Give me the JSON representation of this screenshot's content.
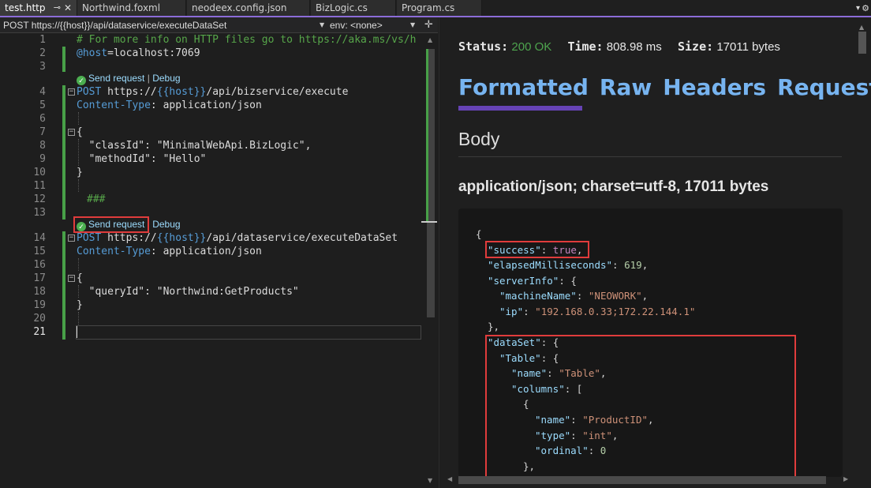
{
  "tabs": [
    {
      "label": "test.http",
      "active": true
    },
    {
      "label": "Northwind.foxml"
    },
    {
      "label": "neodeex.config.json"
    },
    {
      "label": "BizLogic.cs"
    },
    {
      "label": "Program.cs"
    }
  ],
  "tab_pin_glyph": "⊸",
  "tab_close_glyph": "✕",
  "navbar": {
    "request_selector": "POST https://{{host}}/api/dataservice/executeDataSet",
    "env_selector": "env: <none>"
  },
  "editor": {
    "line_numbers": [
      "1",
      "2",
      "3",
      "4",
      "5",
      "6",
      "7",
      "8",
      "9",
      "10",
      "11",
      "12",
      "13",
      "14",
      "15",
      "16",
      "17",
      "18",
      "19",
      "20",
      "21"
    ],
    "codelens": {
      "send": "Send request",
      "separator": "|",
      "debug": "Debug"
    },
    "lines": {
      "l1": "# For more info on HTTP files go to https://aka.ms/vs/h",
      "l2_var": "@host",
      "l2_val": "=localhost:7069",
      "l4_method": "POST",
      "l4_url1": " https://",
      "l4_tpl": "{{host}}",
      "l4_url2": "/api/bizservice/execute",
      "l5_key": "Content-Type",
      "l5_val": ": application/json",
      "l7": "{",
      "l8_key": "  \"classId\"",
      "l8_val": ": \"MinimalWebApi.BizLogic\",",
      "l9_key": "  \"methodId\"",
      "l9_val": ": \"Hello\"",
      "l10": "}",
      "l12": "###",
      "l14_method": "POST",
      "l14_url1": " https://",
      "l14_tpl": "{{host}}",
      "l14_url2": "/api/dataservice/executeDataSet",
      "l15_key": "Content-Type",
      "l15_val": ": application/json",
      "l17": "{",
      "l18_key": "  \"queryId\"",
      "l18_val": ": \"Northwind:GetProducts\"",
      "l19": "}"
    }
  },
  "response": {
    "status_label": "Status:",
    "status_value": "200 OK",
    "time_label": "Time:",
    "time_value": "808.98 ms",
    "size_label": "Size:",
    "size_value": "17011 bytes",
    "view_tabs": [
      "Formatted",
      "Raw",
      "Headers",
      "Request"
    ],
    "active_view_tab": "Formatted",
    "body_heading": "Body",
    "content_type": "application/json; charset=utf-8, 17011 bytes",
    "json_lines": [
      {
        "k": "",
        "v": "{"
      },
      {
        "k": "\"success\"",
        "v": "true",
        "t": "bool",
        "tail": ","
      },
      {
        "k": "\"elapsedMilliseconds\"",
        "v": "619",
        "t": "num",
        "tail": ","
      },
      {
        "k": "\"serverInfo\"",
        "v": "{",
        "t": "punct"
      },
      {
        "k": "\"machineName\"",
        "v": "\"NEOWORK\"",
        "t": "str",
        "tail": ","
      },
      {
        "k": "\"ip\"",
        "v": "\"192.168.0.33;172.22.144.1\"",
        "t": "str"
      },
      {
        "k": "",
        "v": "},"
      },
      {
        "k": "\"dataSet\"",
        "v": "{",
        "t": "punct"
      },
      {
        "k": "\"Table\"",
        "v": "{",
        "t": "punct"
      },
      {
        "k": "\"name\"",
        "v": "\"Table\"",
        "t": "str",
        "tail": ","
      },
      {
        "k": "\"columns\"",
        "v": "[",
        "t": "punct"
      },
      {
        "k": "",
        "v": "{"
      },
      {
        "k": "\"name\"",
        "v": "\"ProductID\"",
        "t": "str",
        "tail": ","
      },
      {
        "k": "\"type\"",
        "v": "\"int\"",
        "t": "str",
        "tail": ","
      },
      {
        "k": "\"ordinal\"",
        "v": "0",
        "t": "num"
      },
      {
        "k": "",
        "v": "},"
      }
    ]
  },
  "colors": {
    "accent": "#8c6cd8",
    "status_ok": "#4ea44e",
    "tab_link": "#77b4f0",
    "highlight_box": "#e03c3c",
    "change_bar": "#48a048"
  }
}
